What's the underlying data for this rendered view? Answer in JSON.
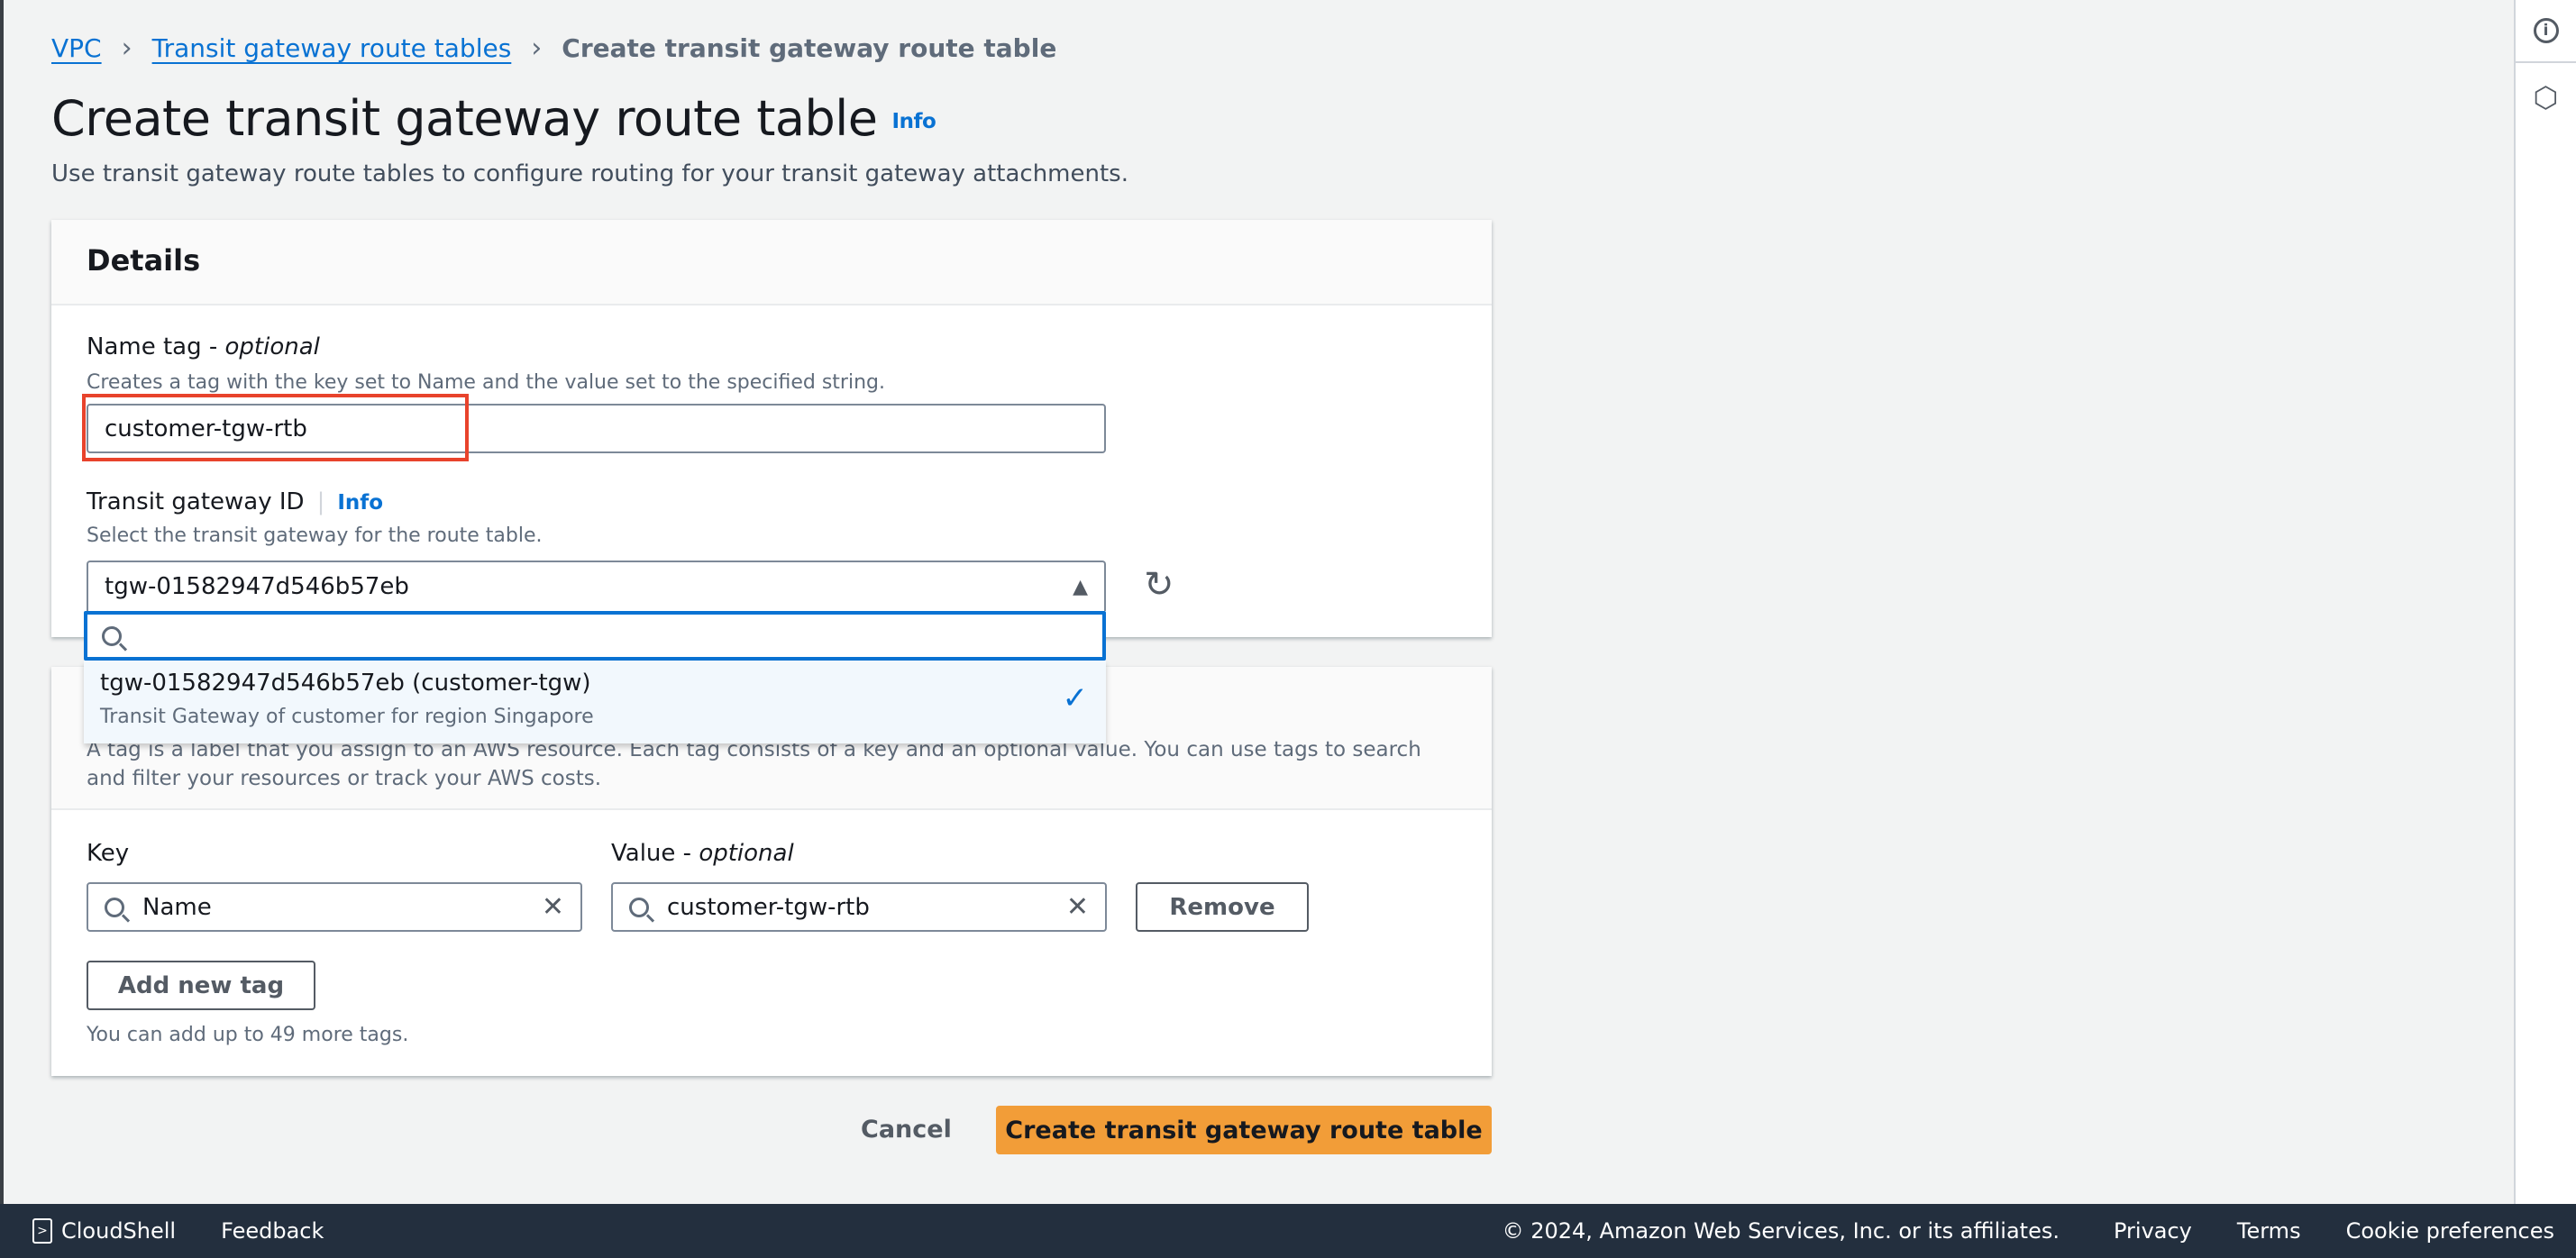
{
  "breadcrumb": [
    {
      "label": "VPC"
    },
    {
      "label": "Transit gateway route tables"
    },
    {
      "label": "Create transit gateway route table"
    }
  ],
  "page": {
    "title": "Create transit gateway route table",
    "info": "Info",
    "description": "Use transit gateway route tables to configure routing for your transit gateway attachments."
  },
  "details": {
    "title": "Details",
    "name_tag": {
      "label": "Name tag - ",
      "label_optional": "optional",
      "help": "Creates a tag with the key set to Name and the value set to the specified string.",
      "value": "customer-tgw-rtb"
    },
    "tgw": {
      "label": "Transit gateway ID",
      "info": "Info",
      "help": "Select the transit gateway for the route table.",
      "selected": "tgw-01582947d546b57eb",
      "search_value": "",
      "options": [
        {
          "label": "tgw-01582947d546b57eb (customer-tgw)",
          "description": "Transit Gateway of customer for region Singapore",
          "selected": true
        }
      ]
    }
  },
  "tags": {
    "description": "A tag is a label that you assign to an AWS resource. Each tag consists of a key and an optional value. You can use tags to search and filter your resources or track your AWS costs.",
    "key_label": "Key",
    "value_label": "Value - ",
    "value_optional": "optional",
    "rows": [
      {
        "key": "Name",
        "value": "customer-tgw-rtb"
      }
    ],
    "remove": "Remove",
    "add": "Add new tag",
    "limit": "You can add up to 49 more tags."
  },
  "actions": {
    "cancel": "Cancel",
    "create": "Create transit gateway route table"
  },
  "footer": {
    "cloudshell": "CloudShell",
    "feedback": "Feedback",
    "copyright": "© 2024, Amazon Web Services, Inc. or its affiliates.",
    "privacy": "Privacy",
    "terms": "Terms",
    "cookies": "Cookie preferences"
  },
  "colors": {
    "primary": "#ec9b3a",
    "link": "#0972d3",
    "highlight": "#e8432c",
    "footer": "#232f3e"
  }
}
